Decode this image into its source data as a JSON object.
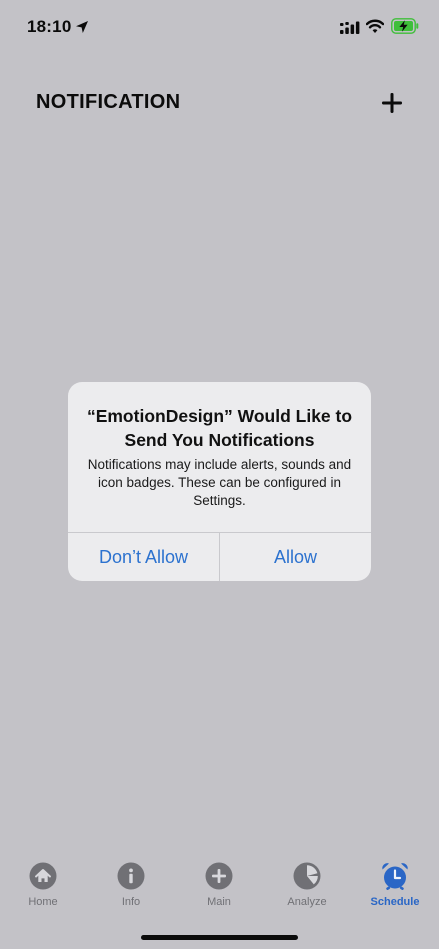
{
  "status_bar": {
    "time": "18:10",
    "icons": [
      "location-arrow-icon",
      "signal-icon",
      "wifi-icon",
      "battery-charging-icon"
    ]
  },
  "header": {
    "title": "NOTIFICATION",
    "add_icon": "plus-icon"
  },
  "alert": {
    "title": "“EmotionDesign” Would Like to Send You Notifications",
    "message": "Notifications may include alerts, sounds and icon badges. These can be configured in Settings.",
    "deny_label": "Don’t Allow",
    "allow_label": "Allow"
  },
  "tab_bar": {
    "items": [
      {
        "label": "Home",
        "icon": "home-icon",
        "active": false
      },
      {
        "label": "Info",
        "icon": "info-icon",
        "active": false
      },
      {
        "label": "Main",
        "icon": "plus-circle-icon",
        "active": false
      },
      {
        "label": "Analyze",
        "icon": "pie-chart-icon",
        "active": false
      },
      {
        "label": "Schedule",
        "icon": "alarm-clock-icon",
        "active": true
      }
    ]
  },
  "colors": {
    "background": "#c3c2c7",
    "alert_background": "#ececee",
    "action_blue": "#2c72cf",
    "tab_active": "#2a66c6",
    "tab_inactive": "#707075",
    "battery_green": "#3fbf3a"
  }
}
